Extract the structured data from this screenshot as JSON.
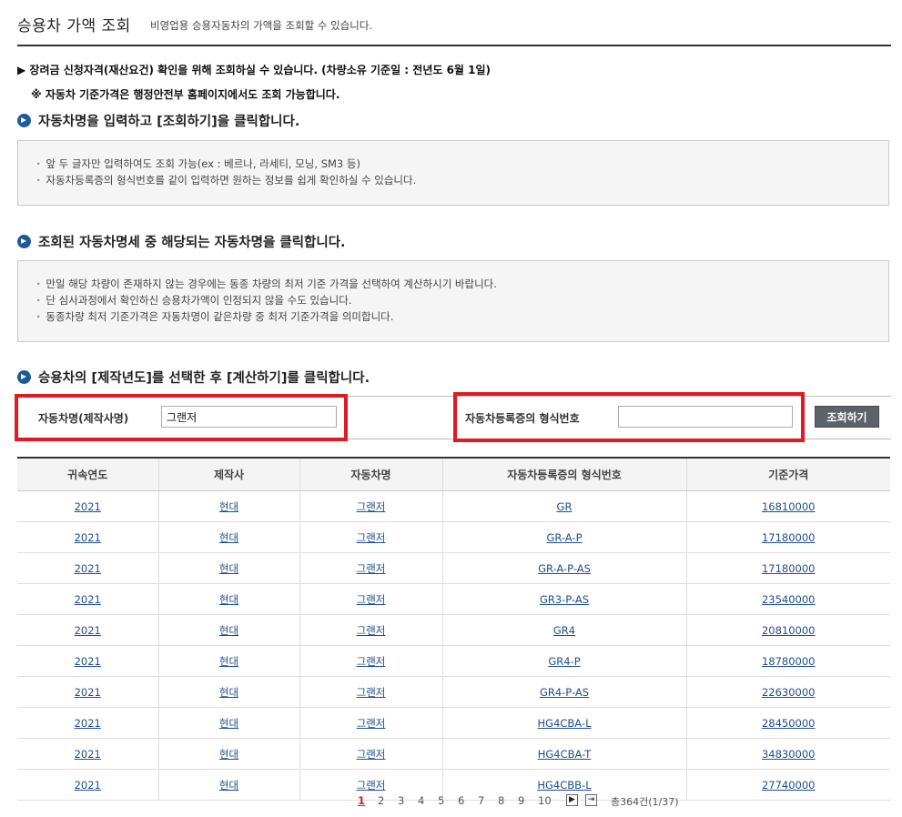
{
  "header": {
    "title": "승용차 가액 조회",
    "subtitle": "비영업용 승용자동차의 가액을 조회할 수 있습니다."
  },
  "notices": {
    "line1": "▶ 장려금 신청자격(재산요건) 확인을 위해 조회하실 수 있습니다. (차량소유 기준일 : 전년도 6월 1일)",
    "line2": "※ 자동차 기준가격은 행정안전부 홈페이지에서도 조회 가능합니다."
  },
  "step1": {
    "heading": "자동차명을 입력하고 [조회하기]을 클릭합니다.",
    "items": [
      "앞 두 글자만 입력하여도 조회 가능(ex : 베르나, 라세티, 모닝, SM3 등)",
      "자동차등록증의 형식번호를 같이 입력하면 원하는 정보를 쉽게 확인하실 수 있습니다."
    ]
  },
  "step2": {
    "heading": "조회된 자동차명세 중 해당되는 자동차명을 클릭합니다.",
    "items": [
      "만일 해당 차량이 존재하지 않는 경우에는 동종 차량의 최저 기준 가격을 선택하여 계산하시기 바랍니다.",
      "단 심사과정에서 확인하신 승용차가액이 인정되지 않을 수도 있습니다.",
      "동종차량 최저 기준가격은 자동차명이 같은차량 중  최저 기준가격을 의미합니다."
    ]
  },
  "step3": {
    "heading": "승용차의 [제작년도]를 선택한 후 [계산하기]를 클릭합니다."
  },
  "search": {
    "car_name_label": "자동차명(제작사명)",
    "car_name_value": "그랜저",
    "model_no_label": "자동차등록증의 형식번호",
    "model_no_value": "",
    "button_label": "조회하기"
  },
  "table": {
    "headers": [
      "귀속연도",
      "제작사",
      "자동차명",
      "자동차등록증의 형식번호",
      "기준가격"
    ],
    "rows": [
      [
        "2021",
        "현대",
        "그랜저",
        "GR",
        "16810000"
      ],
      [
        "2021",
        "현대",
        "그랜저",
        "GR-A-P",
        "17180000"
      ],
      [
        "2021",
        "현대",
        "그랜저",
        "GR-A-P-AS",
        "17180000"
      ],
      [
        "2021",
        "현대",
        "그랜저",
        "GR3-P-AS",
        "23540000"
      ],
      [
        "2021",
        "현대",
        "그랜저",
        "GR4",
        "20810000"
      ],
      [
        "2021",
        "현대",
        "그랜저",
        "GR4-P",
        "18780000"
      ],
      [
        "2021",
        "현대",
        "그랜저",
        "GR4-P-AS",
        "22630000"
      ],
      [
        "2021",
        "현대",
        "그랜저",
        "HG4CBA-L",
        "28450000"
      ],
      [
        "2021",
        "현대",
        "그랜저",
        "HG4CBA-T",
        "34830000"
      ],
      [
        "2021",
        "현대",
        "그랜저",
        "HG4CBB-L",
        "27740000"
      ]
    ]
  },
  "pagination": {
    "pages": [
      "1",
      "2",
      "3",
      "4",
      "5",
      "6",
      "7",
      "8",
      "9",
      "10"
    ],
    "current": "1",
    "next_icon": "▶",
    "last_icon": "⇥",
    "total_text": "총364건(1/37)"
  },
  "colors": {
    "highlight_box": "#e01a22",
    "link": "#1f4e8f",
    "current_page": "#c8252c",
    "button_bg": "#5d6168"
  }
}
